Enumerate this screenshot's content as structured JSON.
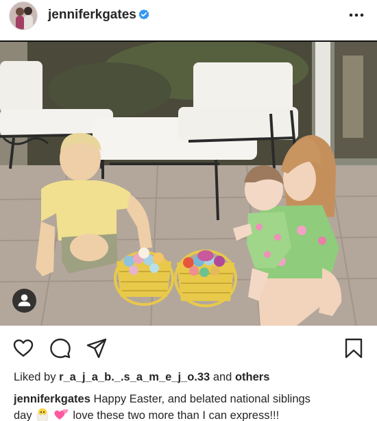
{
  "post": {
    "username": "jenniferkgates",
    "verified": true,
    "more_icon": "more-horizontal-icon",
    "tag_icon": "user-tag-icon"
  },
  "actions": {
    "like_icon": "heart-icon",
    "comment_icon": "comment-icon",
    "share_icon": "paper-plane-icon",
    "save_icon": "bookmark-icon"
  },
  "likes": {
    "prefix": "Liked by",
    "user": "r_a_j_a_b._.s_a_m_e_j_o.33",
    "and": "and",
    "others": "others"
  },
  "caption": {
    "username": "jenniferkgates",
    "text_1": "Happy Easter, and belated national siblings",
    "text_2": "day",
    "emoji_1": "🐣",
    "emoji_2": "💕",
    "text_3": "love these two more than I can express!!!"
  },
  "colors": {
    "verified_blue": "#3897f0",
    "text": "#262626",
    "patio": "#b3a79c"
  }
}
